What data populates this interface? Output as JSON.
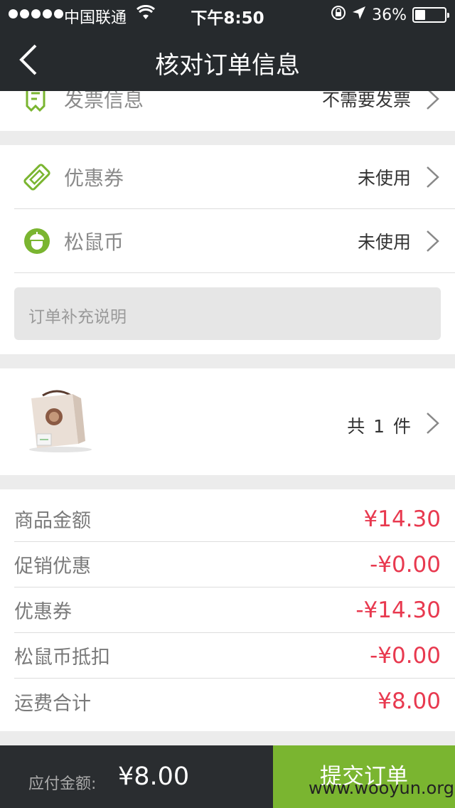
{
  "status_bar": {
    "carrier": "中国联通",
    "time": "下午8:50",
    "battery": "36%",
    "battery_level": 0.36
  },
  "nav": {
    "title": "核对订单信息"
  },
  "invoice": {
    "label": "发票信息",
    "value": "不需要发票"
  },
  "coupon": {
    "label": "优惠券",
    "value": "未使用"
  },
  "squirrel_coin": {
    "label": "松鼠币",
    "value": "未使用"
  },
  "order_note": {
    "placeholder": "订单补充说明"
  },
  "products": {
    "count_text": "共 1 件"
  },
  "summary": {
    "rows": [
      {
        "label": "商品金额",
        "value": "¥14.30"
      },
      {
        "label": "促销优惠",
        "value": "-¥0.00"
      },
      {
        "label": "优惠券",
        "value": "-¥14.30"
      },
      {
        "label": "松鼠币抵扣",
        "value": "-¥0.00"
      },
      {
        "label": "运费合计",
        "value": "¥8.00"
      }
    ]
  },
  "bottom_bar": {
    "total_label": "应付金额:",
    "total_value": "¥8.00",
    "submit_label": "提交订单"
  },
  "watermark": "www.wooyun.org",
  "colors": {
    "accent_green": "#7ab530",
    "price_red": "#e8394f",
    "header_dark": "#262a2d"
  }
}
